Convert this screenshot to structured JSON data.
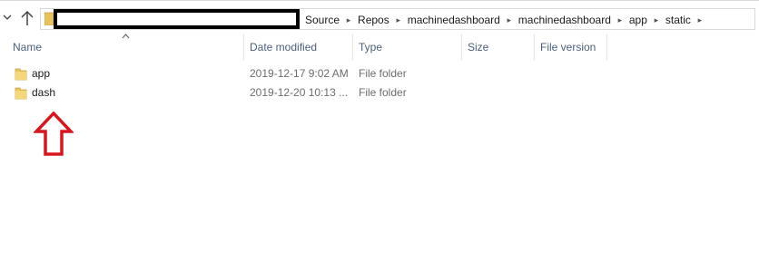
{
  "breadcrumbs": [
    "Source",
    "Repos",
    "machinedashboard",
    "machinedashboard",
    "app",
    "static"
  ],
  "columns": {
    "name": "Name",
    "date_modified": "Date modified",
    "type": "Type",
    "size": "Size",
    "file_version": "File version"
  },
  "files": [
    {
      "name": "app",
      "date_modified": "2019-12-17 9:02 AM",
      "type": "File folder"
    },
    {
      "name": "dash",
      "date_modified": "2019-12-20 10:13 ...",
      "type": "File folder"
    }
  ],
  "colors": {
    "folder": "#e8c25a",
    "annotation": "#d9161e",
    "header_text": "#4c607a"
  }
}
